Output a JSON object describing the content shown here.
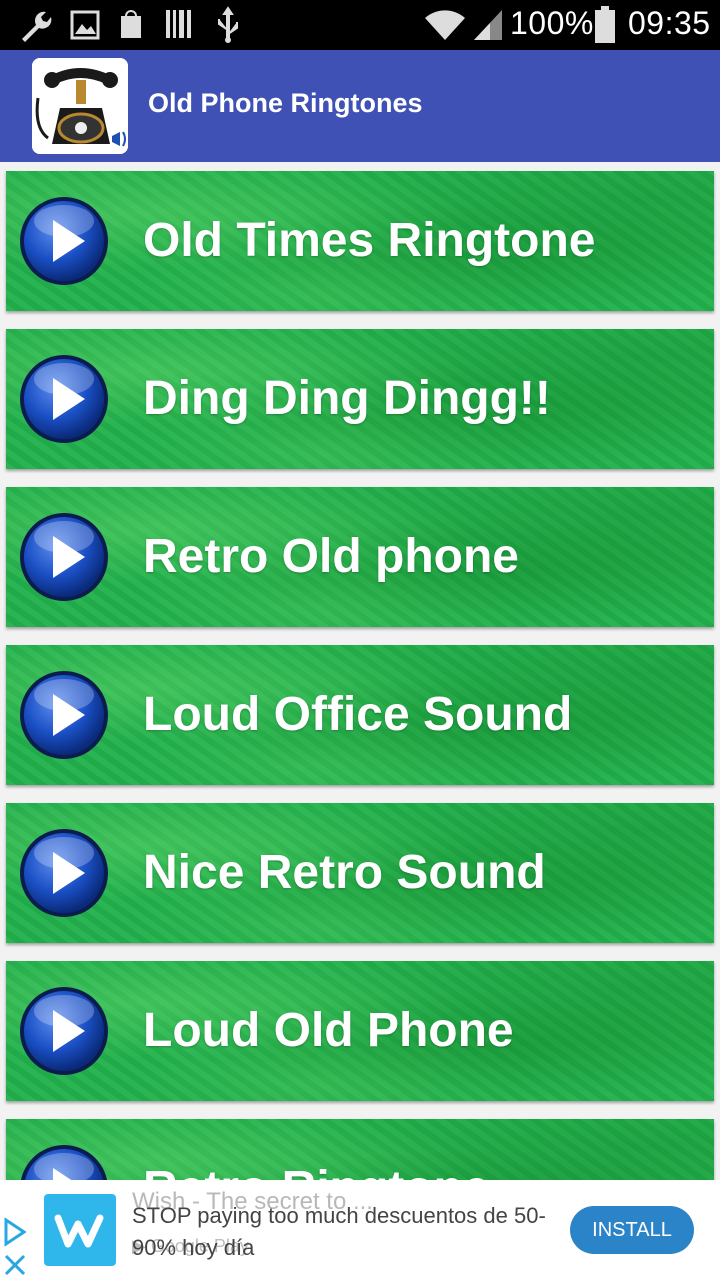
{
  "status_bar": {
    "battery": "100%",
    "time": "09:35",
    "icons": [
      "wrench-icon",
      "image-icon",
      "shopping-bag-icon",
      "barcode-icon",
      "usb-icon",
      "wifi-icon",
      "signal-icon",
      "battery-icon"
    ]
  },
  "app_bar": {
    "title": "Old Phone Ringtones",
    "icon": "old-telephone-icon"
  },
  "ringtones": [
    "Old Times Ringtone",
    "Ding Ding Dingg!!",
    "Retro Old phone",
    "Loud Office Sound",
    "Nice Retro Sound",
    "Loud Old Phone",
    "Retro Ringtone"
  ],
  "colors": {
    "app_bar": "#3f51b5",
    "item_green": "#22b14c",
    "play_blue": "#1a4fc4",
    "install": "#2b84c8"
  },
  "ad": {
    "background_headline": "Wish - The secret to ...",
    "text": "STOP paying too much descuentos de 50-90% hoy día",
    "store": "Google Play",
    "install_label": "INSTALL"
  }
}
